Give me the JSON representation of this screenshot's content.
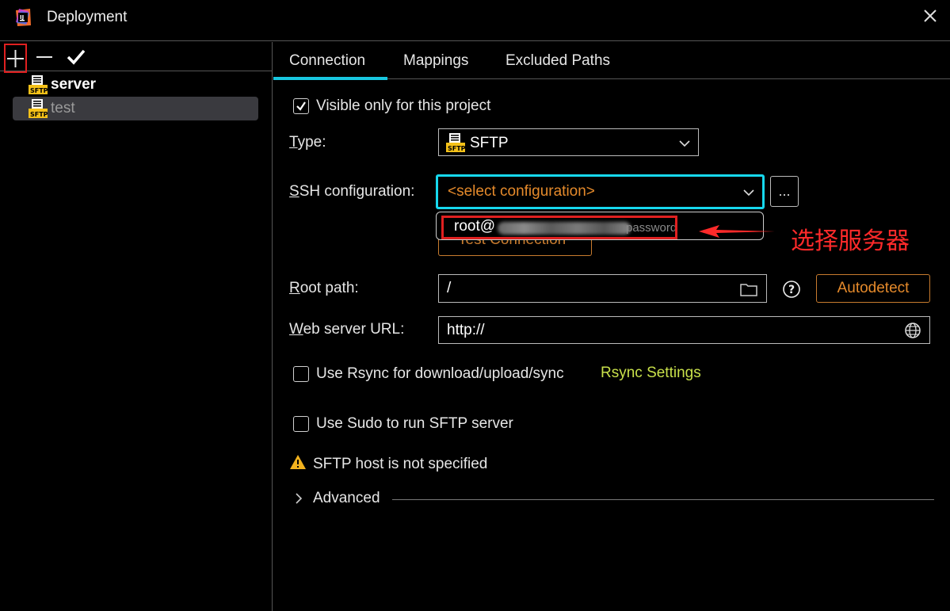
{
  "window": {
    "title": "Deployment"
  },
  "left_toolbar": {
    "add": "+",
    "remove": "—",
    "apply": "✔"
  },
  "tree": [
    {
      "label": "server",
      "icon": "sftp-icon"
    },
    {
      "label": "test",
      "icon": "sftp-icon"
    }
  ],
  "tabs": [
    "Connection",
    "Mappings",
    "Excluded Paths"
  ],
  "form": {
    "visible_only_label": "Visible only for this project",
    "type_label_mnemonic": "T",
    "type_label_rest": "ype:",
    "type_value": "SFTP",
    "ssh_label_mnemonic": "S",
    "ssh_label_rest": "SH configuration:",
    "ssh_placeholder": "<select configuration>",
    "ssh_more": "...",
    "test_connection": "Test Connection",
    "root_label_mnemonic": "R",
    "root_label_rest": "oot path:",
    "root_value": "/",
    "web_label_mnemonic": "W",
    "web_label_rest": "eb server URL:",
    "web_value": "http://",
    "autodetect": "Autodetect",
    "rsync_label": "Use Rsync for download/upload/sync",
    "rsync_link": "Rsync Settings",
    "sudo_label": "Use Sudo to run SFTP server",
    "warning": "SFTP host is not specified",
    "advanced": "Advanced"
  },
  "dropdown": {
    "user": "root@",
    "auth": "password"
  },
  "annotation": {
    "text": "选择服务器",
    "color": "#ff2a2a"
  },
  "colors": {
    "accent": "#18c7e0",
    "orange": "#e58a2b",
    "link": "#c8e04a",
    "annotation": "#ff2a2a"
  }
}
